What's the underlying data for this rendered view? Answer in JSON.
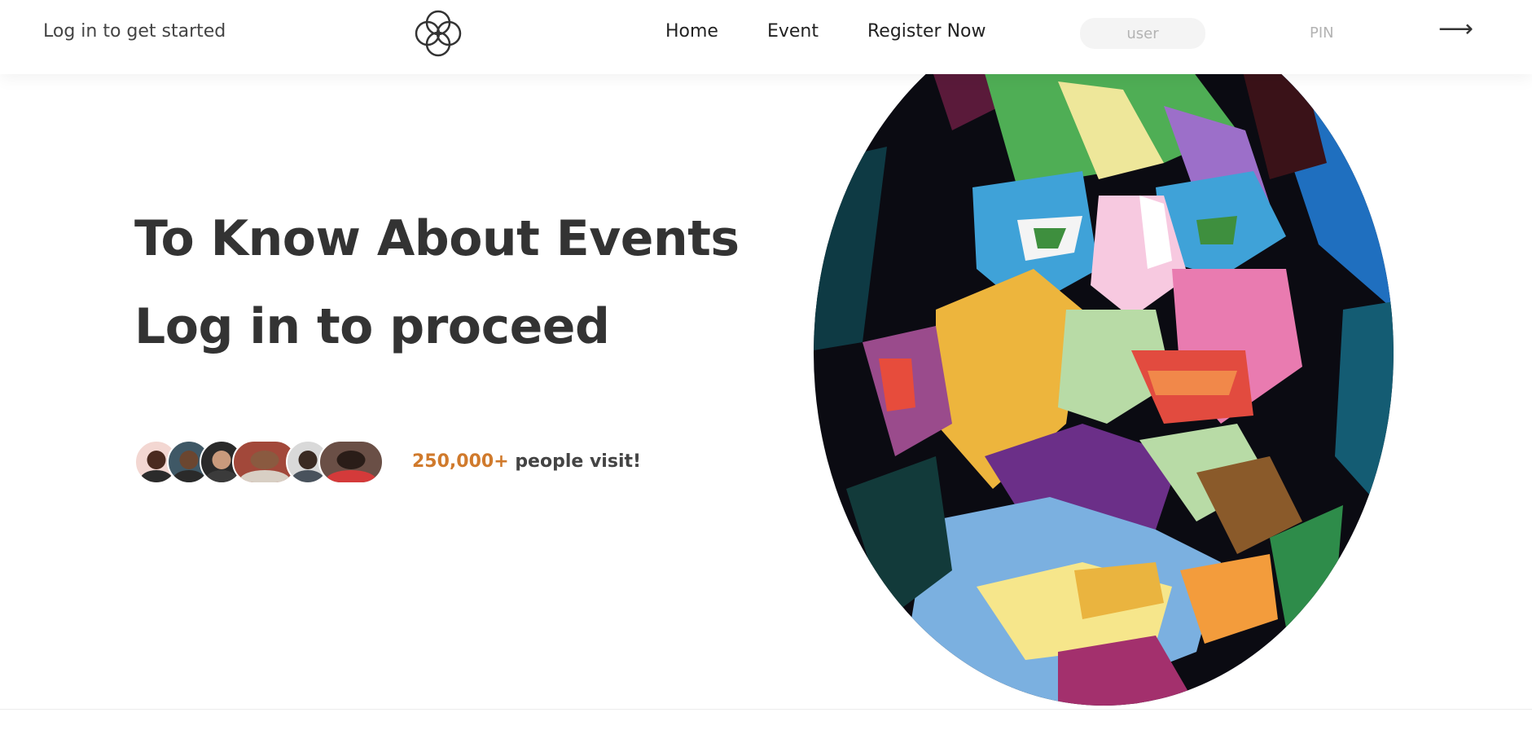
{
  "header": {
    "tagline": "Log in to get started",
    "nav": [
      "Home",
      "Event",
      "Register Now"
    ],
    "login": {
      "user_placeholder": "user",
      "pin_placeholder": "PIN",
      "submit_symbol": "⟶"
    }
  },
  "hero": {
    "line1": "To Know About Events",
    "line2": "Log in to proceed",
    "visit_count": "250,000+",
    "visit_text": "people visit!"
  },
  "icons": {
    "logo": "four-ring-logo-icon",
    "submit": "right-arrow-icon"
  },
  "colors": {
    "accent": "#d07a2c",
    "text": "#333333"
  }
}
